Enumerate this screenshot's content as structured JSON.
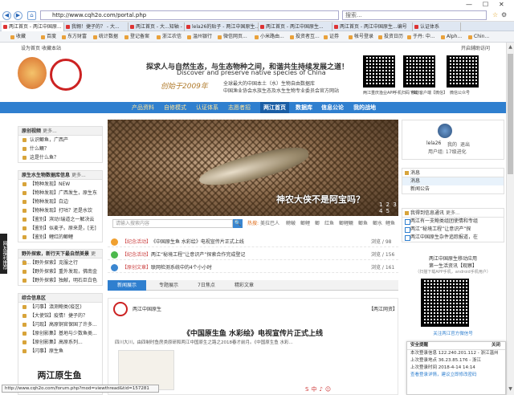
{
  "browser": {
    "url": "http://www.cqh2o.com/portal.php",
    "search_placeholder": "搜索...",
    "tabs": [
      {
        "label": "两江首页 - 两江中国原..."
      },
      {
        "label": "我翱！捷子的？ - 大..."
      },
      {
        "label": "两江首页 - 大...知轴 - 两..."
      },
      {
        "label": "lela26的贴子 - 两江中国原生..."
      },
      {
        "label": "两江首页 - 两江中国原生..."
      },
      {
        "label": "两江首页 - 两江中国原生...编号"
      },
      {
        "label": "认证体系"
      }
    ],
    "favorites": [
      "收藏",
      "百度",
      "东方财富",
      "统计数据",
      "登记备案",
      "浙江农信",
      "温州银行",
      "微信网页...",
      "小米路由...",
      "投资者互...",
      "证券",
      "帐号登录",
      "投资日历",
      "于丹: 中...",
      "Alph...",
      "Chin..."
    ]
  },
  "topbar": {
    "set_home": "设为首页",
    "add_fav": "收藏本站",
    "open_assist": "开启辅助访问"
  },
  "header": {
    "slogan_cn": "探求人与自然生态，与生态物种之间，和谐共生持续发展之道！",
    "slogan_en": "Discover and preserve native species of China",
    "founded": "创始于2009年",
    "intro1": "全球最大的中国本土（水）生物自由数据库",
    "intro2": "中国渔业协会水族生态及水生生物专业委员会官方网站",
    "qr_labels": [
      "两江重庆渔业APP",
      "手机扫码下载",
      "移动客户端【微信】",
      "微信公众号"
    ]
  },
  "nav": [
    {
      "label": "产品资料"
    },
    {
      "label": "自修模式"
    },
    {
      "label": "认证体系"
    },
    {
      "label": "志愿者招"
    },
    {
      "label": "两江首页"
    },
    {
      "label": "数据库"
    },
    {
      "label": "信息公论"
    },
    {
      "label": "我的战地"
    }
  ],
  "left": {
    "box1": {
      "title": "原创视频",
      "more": "更多...",
      "items": [
        "认识鲫鱼，广西产",
        "什么鳜？",
        "这是什么鱼？"
      ]
    },
    "box2": {
      "title": "原生水生物数据库信息",
      "more": "更多...",
      "items": [
        "【物种发现】NEW",
        "【物种发现】广西发生，原生东",
        "【物种发现】白边",
        "【物种发现】打咕？还是水饮",
        "【鉴别】滨动!瑞道之一解决云",
        "【鉴别】似麦子。原来是，[无]",
        "【鉴别】鲤红的鲫鲤"
      ]
    },
    "box3": {
      "title": "野外探索，新行天下最自然美景",
      "more": "更多...",
      "items": [
        "【野外探索】克服之行",
        "【野外探索】重外发现，佛南金",
        "【野外探索】独献，明石巨白色"
      ]
    },
    "box4": {
      "title": "综合信息区",
      "items": [
        "【闪事】滇测鲍类(疫区)",
        "【大使馆】疫情！捷子的？",
        "【闪现】高原铜官保国了许多...",
        "【原创影集】基地与少数鱼类...",
        "【原创影集】高原系列...",
        "【闪事】原生鱼"
      ]
    },
    "stamp": "两江原生鱼"
  },
  "hero": {
    "caption": "神农大侠不是阿宝吗？",
    "dots": "1 2 3 4 5"
  },
  "site_search": {
    "placeholder": "请输入搜索内容",
    "button": "🔍",
    "hot_label": "热搜:",
    "hot": [
      "美拉巴人",
      "鳑鲏",
      "鲫鲤",
      "鲫",
      "红鱼",
      "鲫鲤鳜",
      "鲫鱼",
      "鲫水",
      "鲤鱼"
    ]
  },
  "news": [
    {
      "badge": "",
      "tag": "【纪念活动】",
      "title": "《中国原生鱼 水彩绘》电视宣传片正式上线",
      "stat": "浏览 / 98"
    },
    {
      "badge": "",
      "tag": "【纪念活动】",
      "title": "两江“秘境工程”让意识产”探索合作完成登记",
      "stat": "浏览 / 156"
    },
    {
      "badge": "",
      "tag": "【原创文章】",
      "title": "联网检测系统中的4个小小时",
      "stat": "浏览 / 161"
    }
  ],
  "content_tabs": [
    "新闻展示",
    "专题展示",
    "7日焦点",
    "精彩文章"
  ],
  "article": {
    "author": "两江中国原生",
    "tag": "【两江网资】",
    "title": "《中国原生鱼 水彩绘》电视宣传片正式上线",
    "summary": "四川大川，由四制时鱼房类原研和两江中国原生之路之2018春才前月。《中国原生鱼 水彩..."
  },
  "user": {
    "name": "lela26",
    "links": [
      "我的",
      "退出"
    ],
    "points": "用户组: 17级进化"
  },
  "right": {
    "box1": {
      "title": "消息",
      "items": [
        "消息",
        "新闻公告"
      ]
    },
    "box2": {
      "title": "我得到信息通讯",
      "more": "更多...",
      "items": [
        "两江有一支鲍类组团使情和专组",
        "两江“秘境工程”让意识产”探",
        "两江中国原生杂件追踪报道，在"
      ]
    },
    "promo1": "两江中国原生移动应用",
    "promo2": "第一生活资讯【观察】",
    "promo3": "（扫描下载APP手机，android手机用户）",
    "follow": "关注两江官方微信号"
  },
  "security": {
    "title": "安全提醒",
    "close": "关闭",
    "rows": [
      "本次登录信息 122.240.201.112 - 浙江温州",
      "上次登录地点 36.23.85.176 - 浙江",
      "上次登录时间 2018-4-14 14:14"
    ],
    "link": "查看登录详情，建议立即修改密码"
  },
  "status_url": "http://www.cqh2o.com/forum.php?mod=viewthread&tid=157281",
  "side_promo": "网友福利推荐",
  "colors": {
    "nav": "#2f7fcf",
    "accent": "#f0a030"
  }
}
